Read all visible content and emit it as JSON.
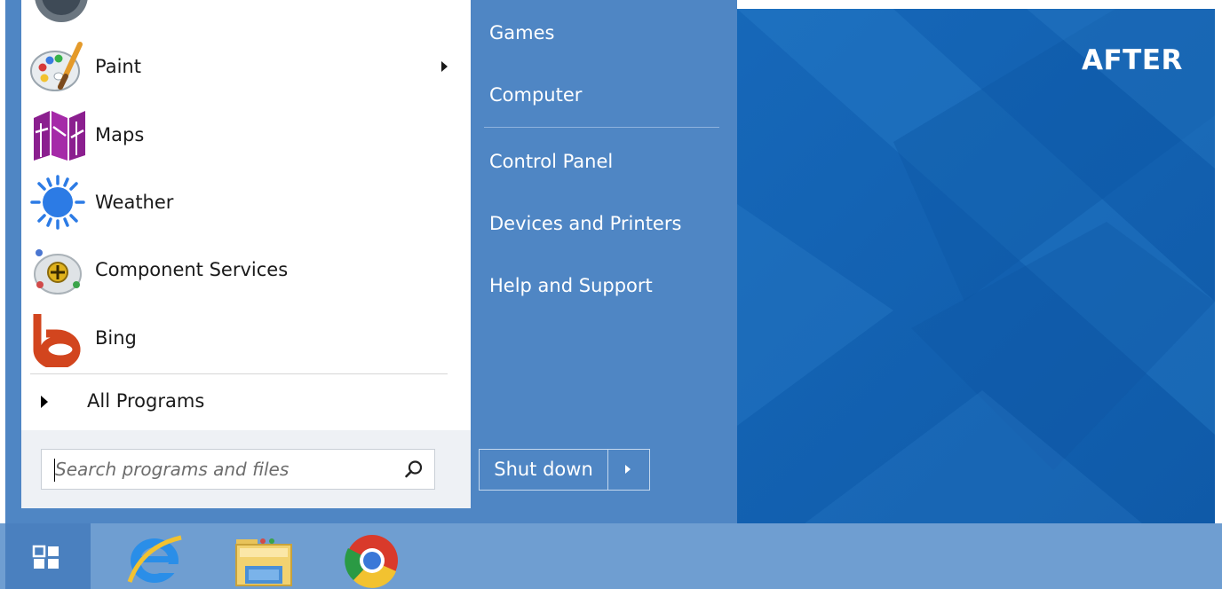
{
  "overlay": {
    "label": "AFTER"
  },
  "start_menu": {
    "programs": [
      {
        "label": "Paint",
        "icon": "paint-icon",
        "has_submenu": true
      },
      {
        "label": "Maps",
        "icon": "maps-icon",
        "has_submenu": false
      },
      {
        "label": "Weather",
        "icon": "weather-icon",
        "has_submenu": false
      },
      {
        "label": "Component Services",
        "icon": "component-services-icon",
        "has_submenu": false
      },
      {
        "label": "Bing",
        "icon": "bing-icon",
        "has_submenu": false
      }
    ],
    "all_programs": "All Programs",
    "search": {
      "placeholder": "Search programs and files",
      "value": ""
    },
    "right_items": [
      "Games",
      "Computer",
      "Control Panel",
      "Devices and Printers",
      "Help and Support"
    ],
    "shutdown_label": "Shut down"
  },
  "taskbar": {
    "items": [
      "start-icon",
      "internet-explorer-icon",
      "file-explorer-icon",
      "chrome-icon"
    ]
  },
  "colors": {
    "menu_blue": "#4f86c4",
    "wallpaper": "#1667b8",
    "taskbar": "#6f9ed1"
  }
}
